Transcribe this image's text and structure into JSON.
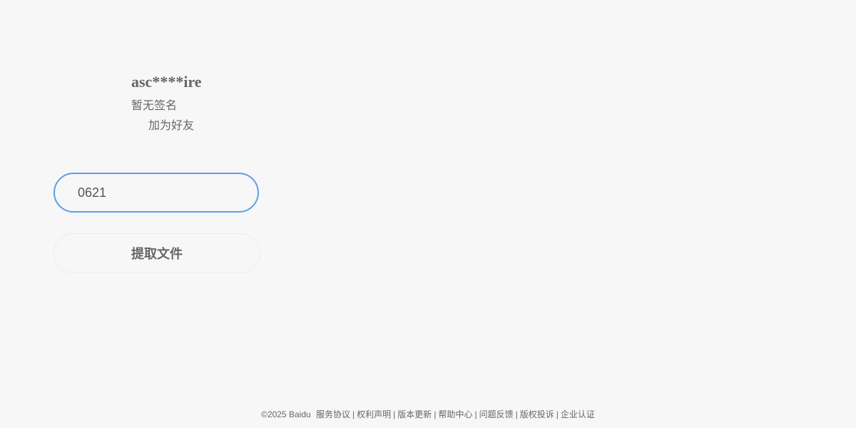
{
  "user": {
    "name": "asc****ire",
    "signature": "暂无签名",
    "add_friend_label": "加为好友"
  },
  "extract": {
    "code_value": "0621",
    "button_label": "提取文件"
  },
  "footer": {
    "copyright": "©2025 Baidu",
    "links": [
      "服务协议",
      "权利声明",
      "版本更新",
      "帮助中心",
      "问题反馈",
      "版权投诉",
      "企业认证"
    ],
    "separator": "|"
  },
  "colors": {
    "background": "#f7f7f7",
    "text": "#666666",
    "input_border": "#5c9ded"
  }
}
